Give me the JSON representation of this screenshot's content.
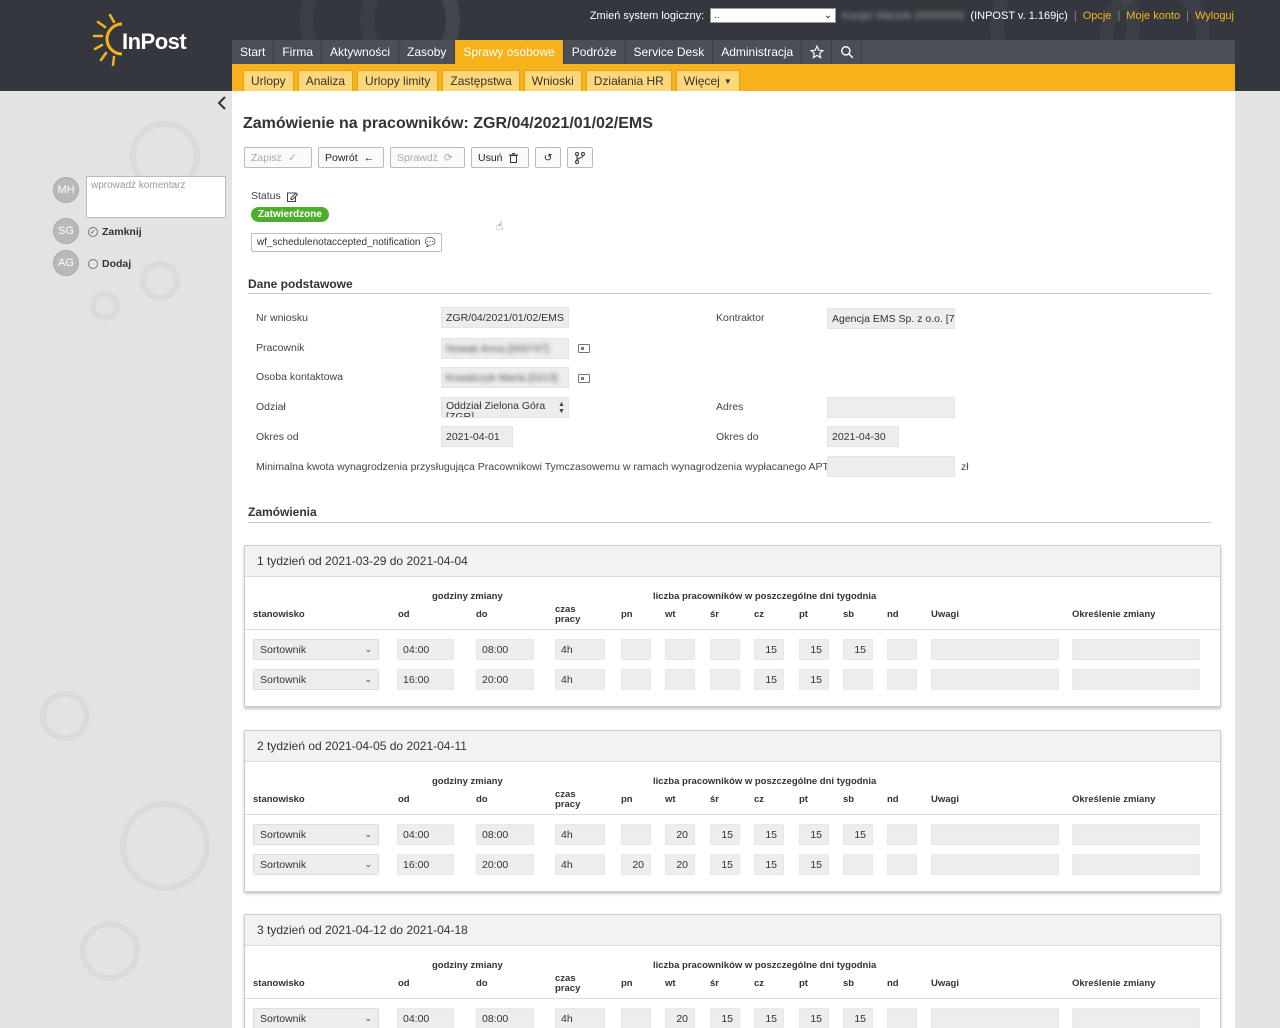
{
  "header": {
    "brand": "InPost",
    "system_label": "Zmień system logiczny:",
    "system_value": "..",
    "user_blurred": "Kasjer Maciek (9999999)",
    "version": "(INPOST v. 1.169jc)",
    "links": [
      "Opcje",
      "Moje konto",
      "Wyloguj"
    ],
    "accent": "#f7b21b"
  },
  "mainnav": [
    {
      "label": "Start",
      "active": false
    },
    {
      "label": "Firma",
      "active": false
    },
    {
      "label": "Aktywności",
      "active": false
    },
    {
      "label": "Zasoby",
      "active": false
    },
    {
      "label": "Sprawy osobowe",
      "active": true
    },
    {
      "label": "Podróże",
      "active": false
    },
    {
      "label": "Service Desk",
      "active": false
    },
    {
      "label": "Administracja",
      "active": false
    }
  ],
  "mainnav_icons": [
    "star-icon",
    "search-icon"
  ],
  "subnav": [
    "Urlopy",
    "Analiza",
    "Urlopy limity",
    "Zastępstwa",
    "Wnioski",
    "Działania HR",
    "Więcej"
  ],
  "sidebar": {
    "comment_placeholder": "wprowadź komentarz",
    "avatars": [
      "MH",
      "SG",
      "AG"
    ],
    "steps": [
      {
        "label": "Zamknij",
        "icon": "check-circle-icon"
      },
      {
        "label": "Dodaj",
        "icon": "circle-icon"
      }
    ]
  },
  "page": {
    "title": "Zamówienie na pracowników: ZGR/04/2021/01/02/EMS",
    "toolbar": {
      "save": "Zapisz",
      "back": "Powrót",
      "check": "Sprawdź",
      "delete": "Usuń"
    },
    "status_label": "Status",
    "status_value": "Zatwierdzone",
    "status_color": "#4caf2c",
    "notification": "wf_schedulenotaccepted_notification"
  },
  "basic": {
    "section_title": "Dane podstawowe",
    "nr_label": "Nr wniosku",
    "nr_value": "ZGR/04/2021/01/02/EMS",
    "contractor_label": "Kontraktor",
    "contractor_value": "Agencja EMS Sp. z o.o. [7",
    "employee_label": "Pracownik",
    "employee_value": "Nowak Anna [000747]",
    "contact_label": "Osoba kontaktowa",
    "contact_value": "Kowalczyk Marta [0213]",
    "branch_label": "Odział",
    "branch_value": "Oddział Zielona Góra [ZGR]",
    "address_label": "Adres",
    "address_value": "",
    "from_label": "Okres od",
    "from_value": "2021-04-01",
    "to_label": "Okres do",
    "to_value": "2021-04-30",
    "minwage_label": "Minimalna kwota wynagrodzenia przysługująca Pracownikowi Tymczasowemu w ramach wynagrodzenia wypłacanego APT",
    "minwage_value": "",
    "currency": "zł"
  },
  "orders": {
    "section_title": "Zamówienia",
    "headers": {
      "shift_hours": "godziny zmiany",
      "count_label": "liczba pracowników w poszczególne dni tygodnia",
      "position": "stanowisko",
      "from": "od",
      "to": "do",
      "work_time": "czas pracy",
      "days": [
        "pn",
        "wt",
        "śr",
        "cz",
        "pt",
        "sb",
        "nd"
      ],
      "notes": "Uwagi",
      "shift_desc": "Określenie zmiany"
    },
    "weeks": [
      {
        "title": "1 tydzień od 2021-03-29 do 2021-04-04",
        "rows": [
          {
            "position": "Sortownik",
            "from": "04:00",
            "to": "08:00",
            "time": "4h",
            "days": [
              "",
              "",
              "",
              "15",
              "15",
              "15",
              ""
            ],
            "notes": "",
            "shift": ""
          },
          {
            "position": "Sortownik",
            "from": "16:00",
            "to": "20:00",
            "time": "4h",
            "days": [
              "",
              "",
              "",
              "15",
              "15",
              "",
              ""
            ],
            "notes": "",
            "shift": ""
          }
        ]
      },
      {
        "title": "2 tydzień od 2021-04-05 do 2021-04-11",
        "rows": [
          {
            "position": "Sortownik",
            "from": "04:00",
            "to": "08:00",
            "time": "4h",
            "days": [
              "",
              "20",
              "15",
              "15",
              "15",
              "15",
              ""
            ],
            "notes": "",
            "shift": ""
          },
          {
            "position": "Sortownik",
            "from": "16:00",
            "to": "20:00",
            "time": "4h",
            "days": [
              "20",
              "20",
              "15",
              "15",
              "15",
              "",
              ""
            ],
            "notes": "",
            "shift": ""
          }
        ]
      },
      {
        "title": "3 tydzień od 2021-04-12 do 2021-04-18",
        "rows": [
          {
            "position": "Sortownik",
            "from": "04:00",
            "to": "08:00",
            "time": "4h",
            "days": [
              "",
              "20",
              "15",
              "15",
              "15",
              "15",
              ""
            ],
            "notes": "",
            "shift": ""
          }
        ]
      }
    ]
  }
}
